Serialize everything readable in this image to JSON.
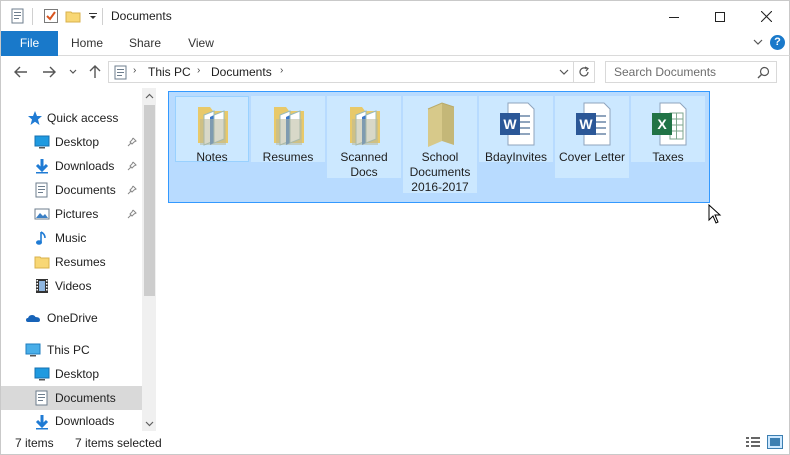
{
  "window": {
    "title": "Documents",
    "minimize_glyph": "—",
    "maximize_glyph": "☐",
    "close_glyph": "✕"
  },
  "ribbon": {
    "tabs": [
      {
        "label": "File"
      },
      {
        "label": "Home"
      },
      {
        "label": "Share"
      },
      {
        "label": "View"
      }
    ],
    "help_glyph": "?"
  },
  "address": {
    "crumbs": [
      "This PC",
      "Documents"
    ],
    "search_placeholder": "Search Documents"
  },
  "nav": {
    "items": [
      {
        "label": "Quick access",
        "icon": "star-icon"
      },
      {
        "label": "Desktop",
        "icon": "desktop-icon",
        "pinned": true
      },
      {
        "label": "Downloads",
        "icon": "downloads-icon",
        "pinned": true
      },
      {
        "label": "Documents",
        "icon": "documents-icon",
        "pinned": true
      },
      {
        "label": "Pictures",
        "icon": "pictures-icon",
        "pinned": true
      },
      {
        "label": "Music",
        "icon": "music-icon"
      },
      {
        "label": "Resumes",
        "icon": "folder-icon"
      },
      {
        "label": "Videos",
        "icon": "videos-icon"
      },
      {
        "label": "OneDrive",
        "icon": "onedrive-icon"
      },
      {
        "label": "This PC",
        "icon": "thispc-icon"
      },
      {
        "label": "Desktop",
        "icon": "desktop-icon"
      },
      {
        "label": "Documents",
        "icon": "documents-icon",
        "selected": true
      },
      {
        "label": "Downloads",
        "icon": "downloads-icon"
      }
    ]
  },
  "files": [
    {
      "name": "Notes",
      "type": "folder"
    },
    {
      "name": "Resumes",
      "type": "folder"
    },
    {
      "name": "Scanned Docs",
      "type": "folder"
    },
    {
      "name": "School Documents 2016-2017",
      "type": "folder"
    },
    {
      "name": "BdayInvites",
      "type": "word"
    },
    {
      "name": "Cover Letter",
      "type": "word"
    },
    {
      "name": "Taxes",
      "type": "excel"
    }
  ],
  "status": {
    "item_count": "7 items",
    "selected_count": "7 items selected"
  },
  "colors": {
    "accent": "#1979ca",
    "selection_fill": "#cce8ff",
    "marquee": "#3399ff"
  }
}
